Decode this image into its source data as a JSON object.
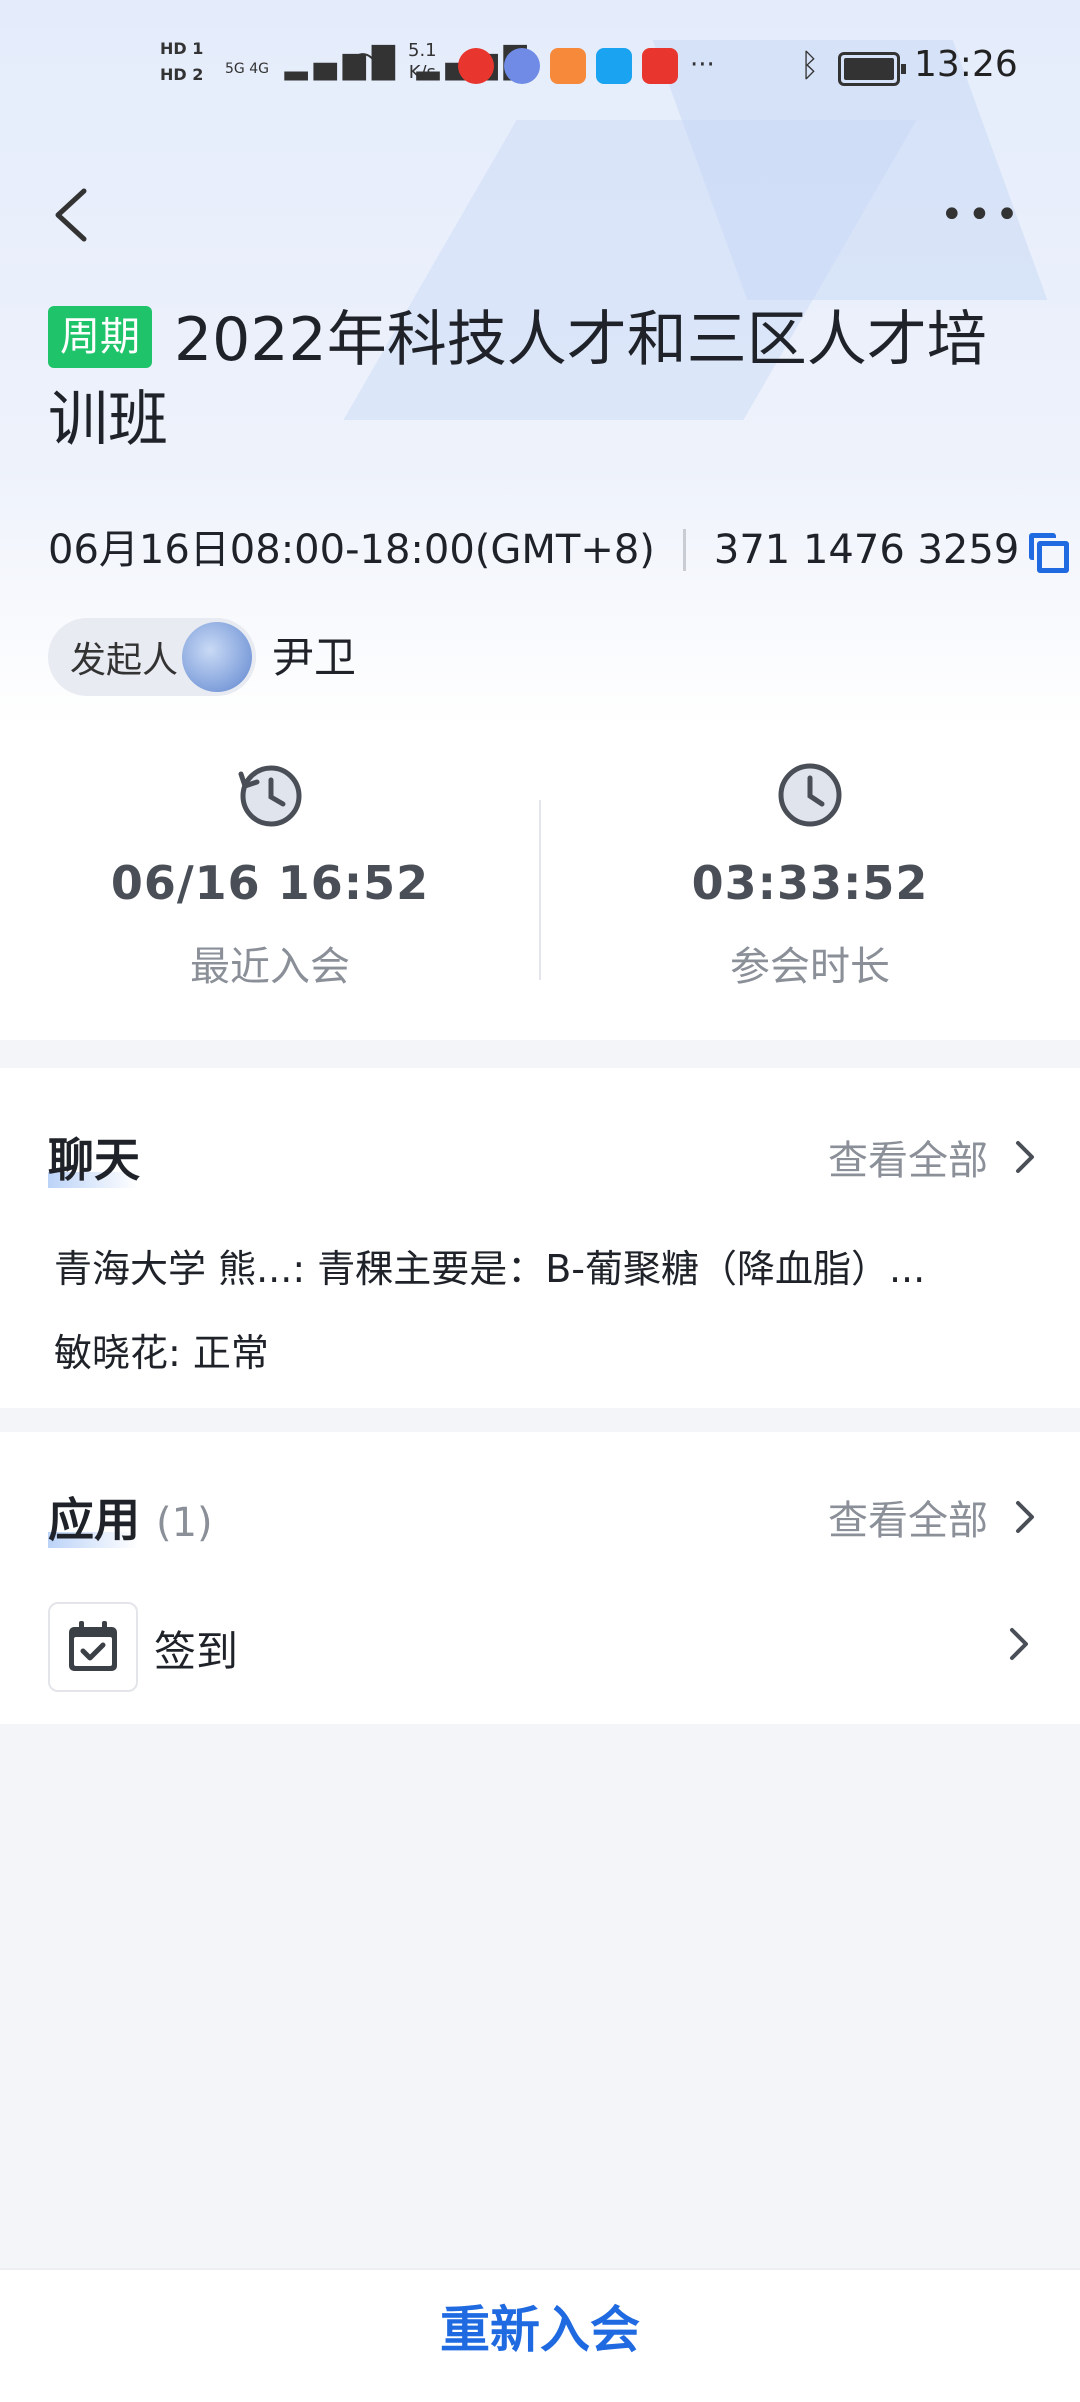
{
  "status_bar": {
    "hd1": "HD 1",
    "hd2": "HD 2",
    "signal": "5G 4G",
    "speed_value": "5.1",
    "speed_unit": "K/s",
    "more": "···",
    "time": "13:26",
    "app_icon_colors": [
      "#e8352d",
      "#6f8be6",
      "#f7893a",
      "#1aa3f0",
      "#e8352d"
    ]
  },
  "nav": {
    "back_icon": "chevron-left-icon",
    "more_icon": "more-dots-icon"
  },
  "meeting": {
    "badge": "周期",
    "title": "2022年科技人才和三区人才培训班",
    "time_range": "06月16日08:00-18:00(GMT+8)",
    "meeting_id": "371 1476 3259",
    "host_label": "发起人",
    "host_name": "尹卫"
  },
  "stats": [
    {
      "value": "06/16 16:52",
      "label": "最近入会",
      "icon": "history-clock-icon"
    },
    {
      "value": "03:33:52",
      "label": "参会时长",
      "icon": "clock-icon"
    }
  ],
  "chat": {
    "title": "聊天",
    "view_all": "查看全部",
    "messages": [
      "青海大学 熊...: 青稞主要是：B-葡聚糖（降血脂）...",
      "敏晓花: 正常"
    ]
  },
  "apps": {
    "title": "应用",
    "count": "(1)",
    "view_all": "查看全部",
    "items": [
      {
        "name": "签到",
        "icon": "calendar-check-icon"
      }
    ]
  },
  "bottom": {
    "rejoin_label": "重新入会"
  },
  "colors": {
    "accent": "#1f6ae0",
    "badge_green": "#1fc46a"
  }
}
